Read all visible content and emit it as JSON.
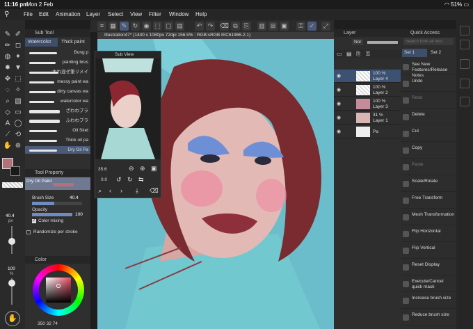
{
  "status": {
    "time": "11:16 pm",
    "date": "Mon 2 Feb",
    "battery": "51%"
  },
  "menu": [
    "File",
    "Edit",
    "Animation",
    "Layer",
    "Select",
    "View",
    "Filter",
    "Window",
    "Help"
  ],
  "document": {
    "title": "Illustration47* (1440 x 1080px 72dpi 156.5% : RGB:sRGB IEC61966-2.1)"
  },
  "subtool": {
    "title": "Sub Tool",
    "tabs": [
      "Watercolor",
      "Thick paint"
    ],
    "brushes": [
      "Bong p",
      "painting brus",
      "すれ混ぜ筆リメイ",
      "messy paint wa",
      "dirty canvas wa",
      "watercolor wa",
      "ざわわブラ",
      "ふわわブラ",
      "Oil Sket",
      "Thick oil pa",
      "Dry Oil Pa"
    ],
    "selected_brush": "Dry Oil Pa"
  },
  "toolprop": {
    "title": "Tool Property",
    "brush_name": "Dry Oil Paint",
    "brush_size_label": "Brush Size",
    "brush_size": "40.4",
    "opacity_label": "Opacity",
    "opacity": "100",
    "color_mixing_label": "Color mixing",
    "randomize_label": "Randomize per stroke"
  },
  "left_sliders": {
    "size": "40.4",
    "size_unit": "px",
    "opacity": "100",
    "opacity_unit": "%"
  },
  "color": {
    "title": "Color",
    "readout": "350 32 74",
    "main": "#b3727a",
    "sub": "#1a1a1a"
  },
  "subview": {
    "title": "Sub View",
    "zoom": "35.6",
    "angle": "0.0"
  },
  "layers": {
    "title": "Layer",
    "blend": "Nor",
    "rows": [
      {
        "opacity": "100 %",
        "name": "Layer 4",
        "selected": true
      },
      {
        "opacity": "100 %",
        "name": "Layer 2",
        "selected": false
      },
      {
        "opacity": "100 %",
        "name": "Layer 3",
        "selected": false
      },
      {
        "opacity": "31 %",
        "name": "Layer 1",
        "selected": false
      },
      {
        "opacity": "",
        "name": "Pa",
        "selected": false
      }
    ]
  },
  "quick_access": {
    "title": "Quick Access",
    "search_placeholder": "Search from all func",
    "tabs": [
      "Set 1",
      "Set 2"
    ],
    "items": [
      {
        "label": "See New Features/Release Notes",
        "enabled": true
      },
      {
        "label": "Undo",
        "enabled": true
      },
      {
        "label": "Redo",
        "enabled": false
      },
      {
        "label": "Delete",
        "enabled": true
      },
      {
        "label": "Cut",
        "enabled": true
      },
      {
        "label": "Copy",
        "enabled": true
      },
      {
        "label": "Paste",
        "enabled": false
      },
      {
        "label": "Scale/Rotate",
        "enabled": true
      },
      {
        "label": "Free Transform",
        "enabled": true
      },
      {
        "label": "Mesh Transformation",
        "enabled": true
      },
      {
        "label": "Flip Horizontal",
        "enabled": true
      },
      {
        "label": "Flip Vertical",
        "enabled": true
      },
      {
        "label": "Reset Display",
        "enabled": true
      },
      {
        "label": "Execute/Cancel quick mask",
        "enabled": true
      },
      {
        "label": "Increase brush size",
        "enabled": true
      },
      {
        "label": "Reduce brush size",
        "enabled": true
      }
    ]
  }
}
